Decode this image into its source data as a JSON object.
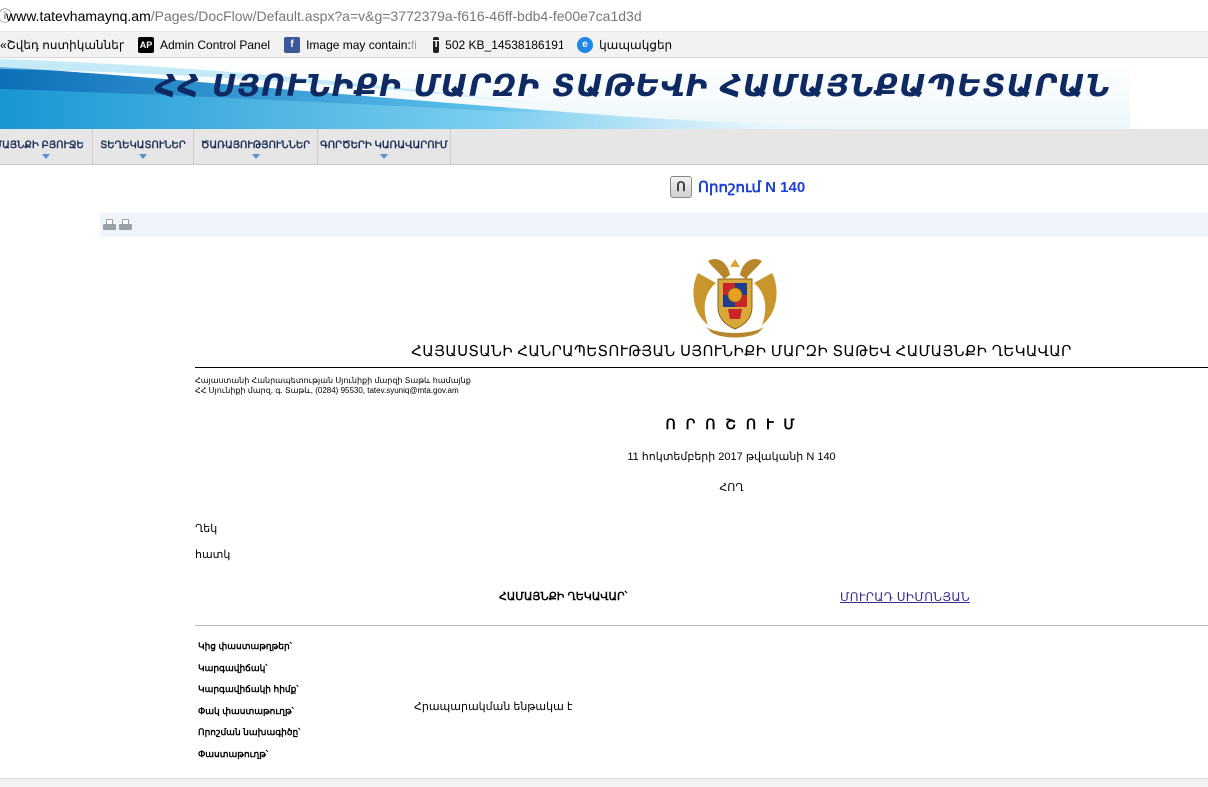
{
  "browser": {
    "url_host": "www.tatevhamaynq.am",
    "url_path": "/Pages/DocFlow/Default.aspx?a=v&g=3772379a-f616-46ff-bdb4-fe00e7ca1d3d",
    "bookmarks": [
      {
        "label": "«Շվեդ ոստիկաններ",
        "icon": "sun-icon"
      },
      {
        "label": "Admin Control Panel",
        "icon": "ap-logo-icon",
        "icon_text": "AP"
      },
      {
        "label": "Image may contain: ",
        "fade": "fi",
        "icon": "facebook-icon",
        "icon_text": "f"
      },
      {
        "label": "502 KB_14538186191",
        "icon": "t-icon",
        "icon_text": "T"
      },
      {
        "label": "կապակցեր",
        "icon": "e-icon",
        "icon_text": "e"
      }
    ]
  },
  "banner": {
    "title": "ՀՀ ՍՅՈՒՆԻՔԻ ՄԱՐԶԻ ՏԱԹԵՎԻ ՀԱՄԱՅՆՔԱՊԵՏԱՐԱՆ"
  },
  "nav": {
    "items": [
      {
        "label": "ՄԱՅՆՔԻ ԲՅՈՒՋԵ"
      },
      {
        "label": "ՏԵՂԵԿԱՏՈՒՆԵՐ"
      },
      {
        "label": "ԾԱՌԱՅՈՒԹՅՈՒՆՆԵՐ"
      },
      {
        "label": "ԳՈՐԾԵՐԻ ԿԱՌԱՎԱՐՈՒՄ"
      }
    ]
  },
  "doc": {
    "icon_text": "Ո",
    "title": "Որոշում N 140",
    "republic": "ՀԱՅԱՍՏԱՆԻ ՀԱՆՐԱՊԵՏՈՒԹՅԱՆ ՍՅՈՒՆԻՔԻ ՄԱՐԶԻ ՏԱԹԵՎ ՀԱՄԱՅՆՔԻ ՂԵԿԱՎԱՐ",
    "address_line1": "Հայաստանի Հանրապետության Սյունիքի մարզի Տաթև համայնք",
    "address_line2": "ՀՀ Սյունիքի մարզ, գ. Տաթև, (0284) 95530, tatev.syuniq@mta.gov.am",
    "decree": "Ո Ր Ո Շ Ո Ւ Մ",
    "date": "11 հոկտեմբերի 2017 թվականի N 140",
    "about": "ՀՈՂ",
    "paragraph1": "Ղեկ",
    "paragraph2": "հատկ",
    "head_label": "ՀԱՄԱՅՆՔԻ ՂԵԿԱՎԱՐ՝",
    "head_name": "ՄՈՒՐԱԴ ՍԻՄՈՆՅԱՆ",
    "meta_labels": [
      "Կից փաստաթղթեր՝",
      "Կարգավիճակ՝",
      "Կարգավիճակի հիմք՝",
      "Փակ փաստաթուղթ՝",
      "Որոշման նախագիծը՝",
      "Փաստաթուղթ՝"
    ],
    "meta_value_closed": "Հրապարակման ենթակա է"
  }
}
